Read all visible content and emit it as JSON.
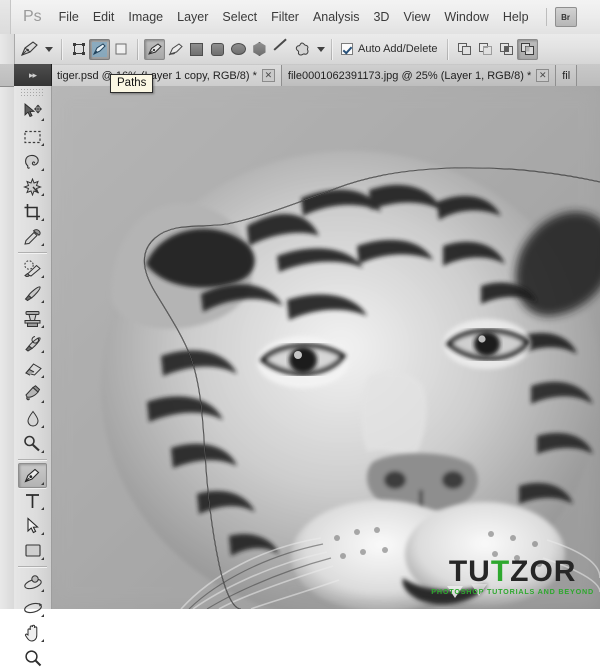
{
  "app": {
    "name": "Adobe Photoshop",
    "logo": "Ps",
    "bridge_button": "Br"
  },
  "menubar": {
    "items": [
      {
        "label": "File"
      },
      {
        "label": "Edit"
      },
      {
        "label": "Image"
      },
      {
        "label": "Layer"
      },
      {
        "label": "Select"
      },
      {
        "label": "Filter"
      },
      {
        "label": "Analysis"
      },
      {
        "label": "3D"
      },
      {
        "label": "View"
      },
      {
        "label": "Window"
      },
      {
        "label": "Help"
      }
    ]
  },
  "options_bar": {
    "tool_preset_icon": "pen-tool-icon",
    "mode_buttons": [
      {
        "name": "shape-layers",
        "selected": false
      },
      {
        "name": "paths",
        "selected": true
      },
      {
        "name": "fill-pixels",
        "selected": false
      }
    ],
    "tool_buttons": [
      {
        "name": "pen-tool",
        "selected": true
      },
      {
        "name": "freeform-pen-tool",
        "selected": false
      },
      {
        "name": "rectangle-tool",
        "selected": false
      },
      {
        "name": "rounded-rectangle-tool",
        "selected": false
      },
      {
        "name": "ellipse-tool",
        "selected": false
      },
      {
        "name": "polygon-tool",
        "selected": false
      },
      {
        "name": "line-tool",
        "selected": false
      },
      {
        "name": "custom-shape-tool",
        "selected": false
      }
    ],
    "auto_add_delete": {
      "label": "Auto Add/Delete",
      "checked": true
    },
    "path_ops": [
      {
        "name": "add-to-path-area",
        "selected": false
      },
      {
        "name": "subtract-from-path-area",
        "selected": false
      },
      {
        "name": "intersect-path-areas",
        "selected": false
      },
      {
        "name": "exclude-overlapping-path-areas",
        "selected": true
      }
    ]
  },
  "tabs": {
    "items": [
      {
        "label": "tiger.psd @ 16% (Layer 1 copy, RGB/8) *",
        "active": true,
        "close": "✕"
      },
      {
        "label": "file0001062391173.jpg @ 25% (Layer 1, RGB/8) *",
        "active": false,
        "close": "✕"
      },
      {
        "label": "fil",
        "active": false,
        "close": ""
      }
    ]
  },
  "tooltip": {
    "text": "Paths"
  },
  "panel_toggle": {
    "icon": "double-right-arrow-icon",
    "glyph": "▸▸"
  },
  "toolbox": {
    "tools": [
      {
        "name": "move-tool",
        "label": "Move Tool",
        "selected": false,
        "has_flyout": true
      },
      {
        "name": "rectangular-marquee-tool",
        "label": "Rectangular Marquee Tool",
        "selected": false,
        "has_flyout": true
      },
      {
        "name": "lasso-tool",
        "label": "Lasso Tool",
        "selected": false,
        "has_flyout": true
      },
      {
        "name": "quick-selection-tool",
        "label": "Quick Selection Tool",
        "selected": false,
        "has_flyout": true
      },
      {
        "name": "crop-tool",
        "label": "Crop Tool",
        "selected": false,
        "has_flyout": true
      },
      {
        "name": "eyedropper-tool",
        "label": "Eyedropper Tool",
        "selected": false,
        "has_flyout": true
      },
      {
        "name": "spot-healing-brush-tool",
        "label": "Spot Healing Brush Tool",
        "selected": false,
        "has_flyout": true
      },
      {
        "name": "brush-tool",
        "label": "Brush Tool",
        "selected": false,
        "has_flyout": true
      },
      {
        "name": "clone-stamp-tool",
        "label": "Clone Stamp Tool",
        "selected": false,
        "has_flyout": true
      },
      {
        "name": "history-brush-tool",
        "label": "History Brush Tool",
        "selected": false,
        "has_flyout": true
      },
      {
        "name": "eraser-tool",
        "label": "Eraser Tool",
        "selected": false,
        "has_flyout": true
      },
      {
        "name": "gradient-tool",
        "label": "Gradient Tool",
        "selected": false,
        "has_flyout": true
      },
      {
        "name": "blur-tool",
        "label": "Blur Tool",
        "selected": false,
        "has_flyout": true
      },
      {
        "name": "dodge-tool",
        "label": "Dodge Tool",
        "selected": false,
        "has_flyout": true
      },
      {
        "name": "pen-tool",
        "label": "Pen Tool",
        "selected": true,
        "has_flyout": true
      },
      {
        "name": "horizontal-type-tool",
        "label": "Horizontal Type Tool",
        "selected": false,
        "has_flyout": true
      },
      {
        "name": "path-selection-tool",
        "label": "Path Selection Tool",
        "selected": false,
        "has_flyout": true
      },
      {
        "name": "rectangle-shape-tool",
        "label": "Rectangle Tool",
        "selected": false,
        "has_flyout": true
      },
      {
        "name": "3d-object-rotate-tool",
        "label": "3D Object Rotate Tool",
        "selected": false,
        "has_flyout": true
      },
      {
        "name": "3d-rotate-camera-tool",
        "label": "3D Rotate Camera Tool",
        "selected": false,
        "has_flyout": true
      },
      {
        "name": "hand-tool",
        "label": "Hand Tool",
        "selected": false,
        "has_flyout": true
      },
      {
        "name": "zoom-tool",
        "label": "Zoom Tool",
        "selected": false,
        "has_flyout": false
      }
    ]
  },
  "canvas": {
    "document": "tiger.psd",
    "zoom": "16%",
    "subject": "grayscale tiger head photograph with an active pen path outline traced around the head",
    "path_stroke_color": "#1a1a1a"
  },
  "watermark": {
    "part1": "TU",
    "part_mid": "T",
    "part2": "ZOR",
    "subtitle": "PHOTOSHOP TUTORIALS AND BEYOND",
    "accent_color": "#2ea82e",
    "dark_color": "#262626"
  }
}
